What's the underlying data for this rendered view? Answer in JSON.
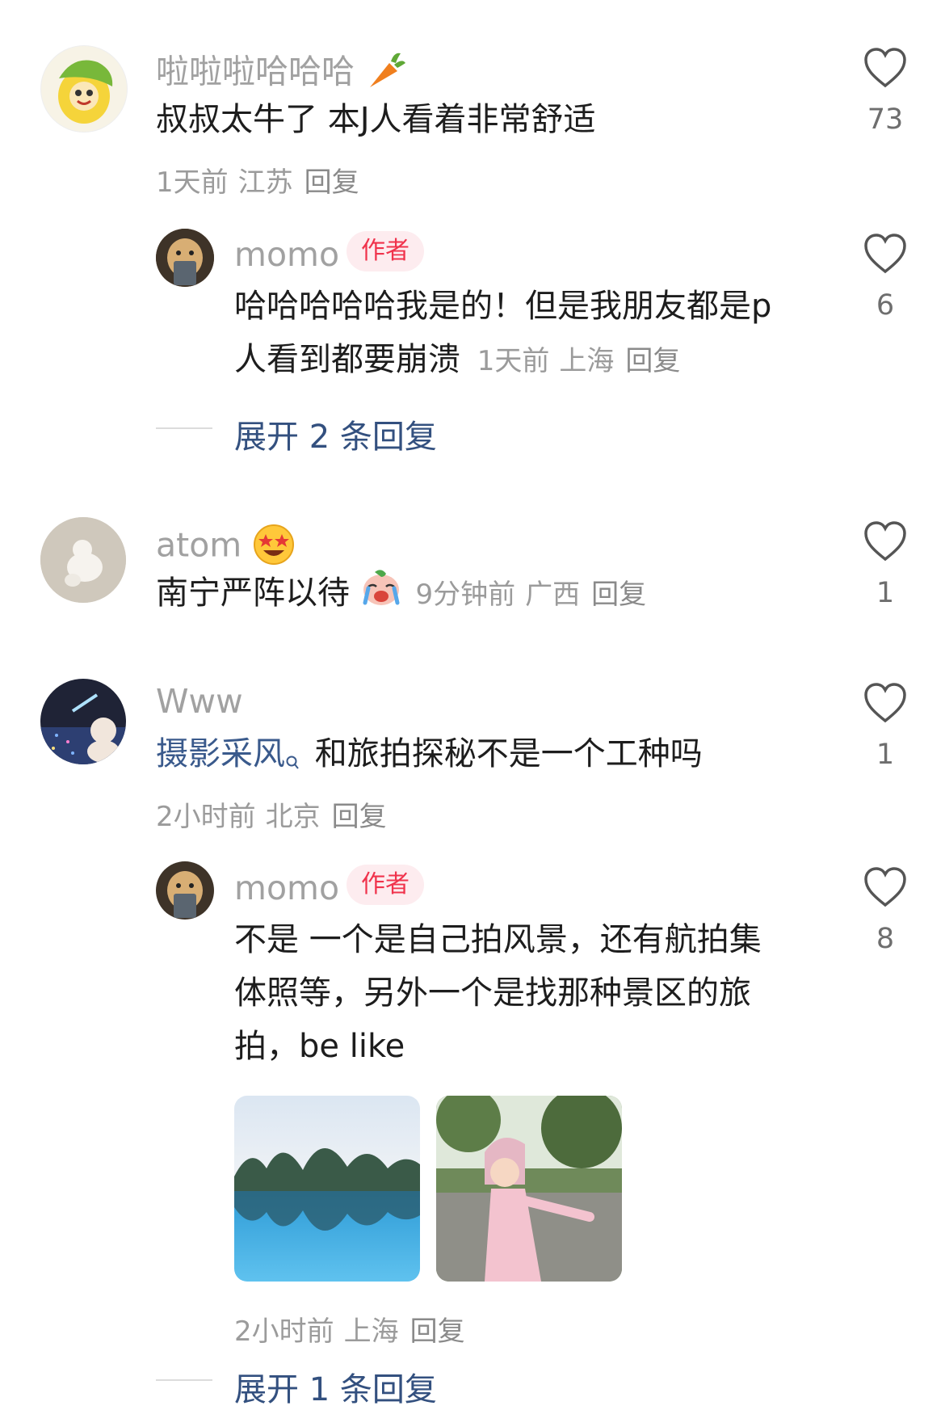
{
  "comments": [
    {
      "username": "啦啦啦哈哈哈",
      "text": "叔叔太牛了 本J人看着非常舒适",
      "time": "1天前",
      "location": "江苏",
      "reply_label": "回复",
      "likes": "73",
      "replies": [
        {
          "username": "momo",
          "badge": "作者",
          "text_line1": "哈哈哈哈哈我是的！但是我朋友都是p",
          "text_line2": "人看到都要崩溃",
          "time": "1天前",
          "location": "上海",
          "reply_label": "回复",
          "likes": "6"
        }
      ],
      "expand_label": "展开 2 条回复"
    },
    {
      "username": "atom",
      "text": "南宁严阵以待",
      "time": "9分钟前",
      "location": "广西",
      "reply_label": "回复",
      "likes": "1"
    },
    {
      "username": "Www",
      "link_text": "摄影采风",
      "text": "和旅拍探秘不是一个工种吗",
      "time": "2小时前",
      "location": "北京",
      "reply_label": "回复",
      "likes": "1",
      "replies": [
        {
          "username": "momo",
          "badge": "作者",
          "text_line1": "不是 一个是自己拍风景，还有航拍集",
          "text_line2": "体照等，另外一个是找那种景区的旅",
          "text_line3": "拍，be like",
          "time": "2小时前",
          "location": "上海",
          "reply_label": "回复",
          "likes": "8"
        }
      ],
      "expand_label": "展开 1 条回复"
    }
  ],
  "icons": {
    "heart": "heart-outline-icon",
    "carrot": "carrot-emoji",
    "star_eyes": "star-struck-emoji",
    "crying": "crying-emoji",
    "search": "search-icon"
  },
  "colors": {
    "username": "#a1a1a1",
    "text": "#1d1d1d",
    "meta": "#9b9b9b",
    "badge_bg": "#fdecef",
    "badge_text": "#f0334c",
    "expand_link": "#33507f"
  }
}
